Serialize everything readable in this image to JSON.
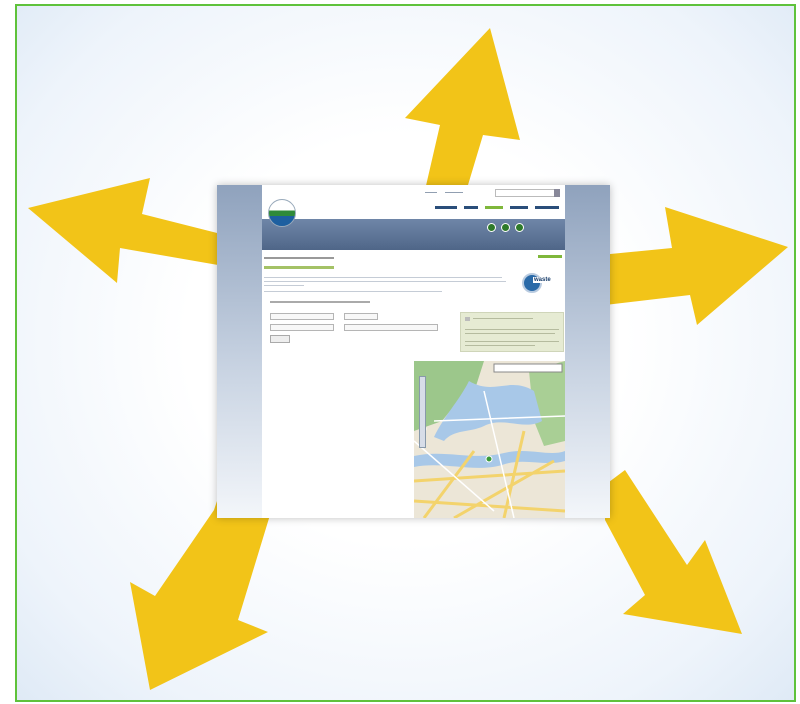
{
  "image": {
    "colors": {
      "frame_border": "#5fc23b",
      "arrow_fill": "#f2c418",
      "header_blue": "#4f6688",
      "accent_green": "#7fb73b"
    },
    "arrow_directions": [
      "up",
      "upper-left",
      "upper-right",
      "lower-left",
      "lower-right"
    ]
  },
  "website": {
    "logo_text": "",
    "nav_items": [],
    "breadcrumb": "",
    "page_title": "",
    "badge_text": "waste"
  }
}
